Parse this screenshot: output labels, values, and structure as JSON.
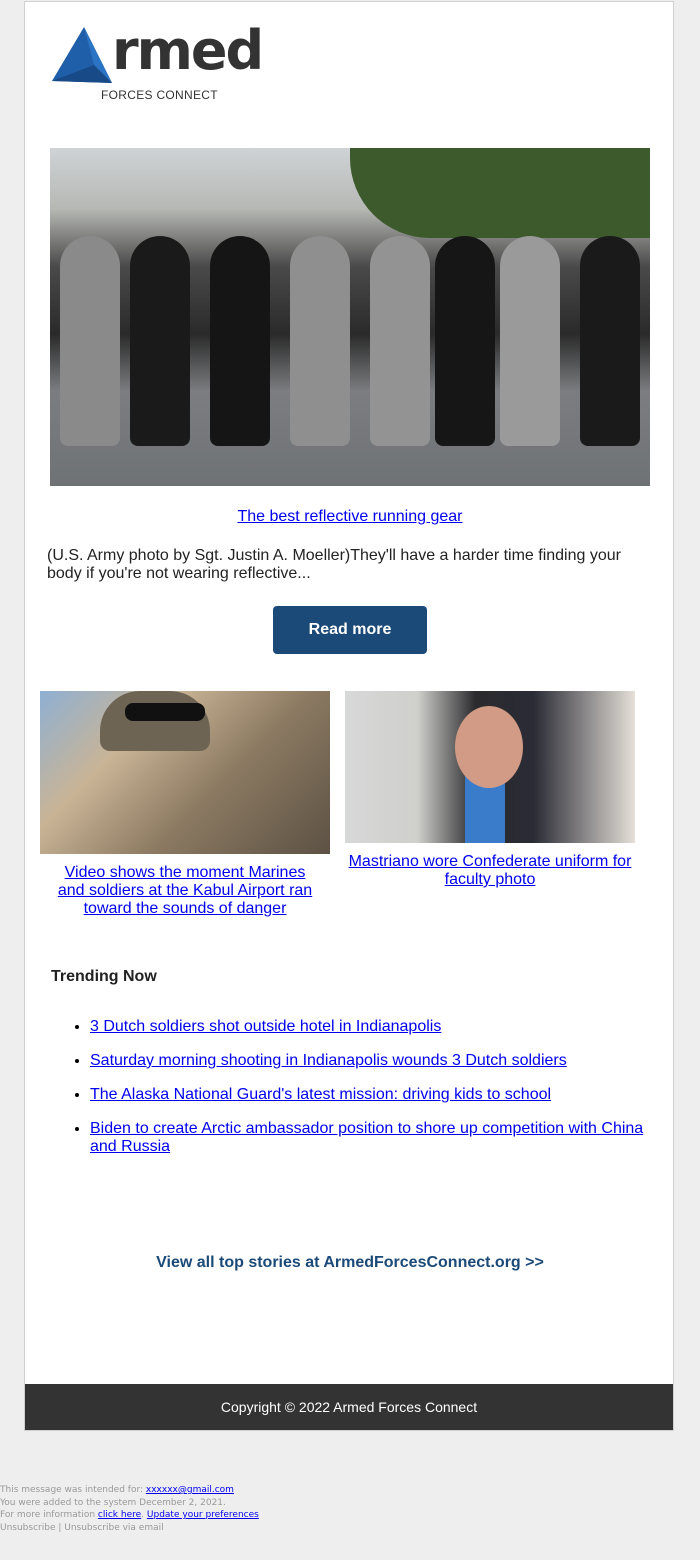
{
  "brand": {
    "logo_word": "rmed",
    "logo_sub": "FORCES CONNECT",
    "logo_color": "#1f5ea8"
  },
  "hero": {
    "image_alt": "Soldiers in ARMY shirts running with reflective belts",
    "title": "The best reflective running gear",
    "description": "(U.S. Army photo by Sgt. Justin A. Moeller)They'll have a harder time finding your body if you're not wearing reflective...",
    "button_label": "Read more",
    "button_color": "#1b4a78"
  },
  "stories": [
    {
      "title": "Video shows the moment Marines and soldiers at the Kabul Airport ran toward the sounds of danger",
      "image_alt": "Marines in helmets and sunglasses at Kabul Airport"
    },
    {
      "title": "Mastriano wore Confederate uniform for faculty photo",
      "image_alt": "Man speaking at a microphone"
    }
  ],
  "trending": {
    "heading": "Trending Now",
    "items": [
      "3 Dutch soldiers shot outside hotel in Indianapolis",
      "Saturday morning shooting in Indianapolis wounds 3 Dutch soldiers",
      "The Alaska National Guard's latest mission: driving kids to school",
      "Biden to create Arctic ambassador position to shore up competition with China and Russia"
    ]
  },
  "view_all": "View all top stories at ArmedForcesConnect.org >>",
  "footer": {
    "copyright": "Copyright © 2022 Armed Forces Connect"
  },
  "meta": {
    "intended_prefix": "This message was intended for: ",
    "email": "xxxxxx@gmail.com",
    "added": "You were added to the system December 2, 2021.",
    "more_info_prefix": "For more information ",
    "click_here": "click here",
    "separator": ". ",
    "update_prefs": "Update your preferences",
    "unsubscribe": "Unsubscribe | Unsubscribe via email"
  }
}
